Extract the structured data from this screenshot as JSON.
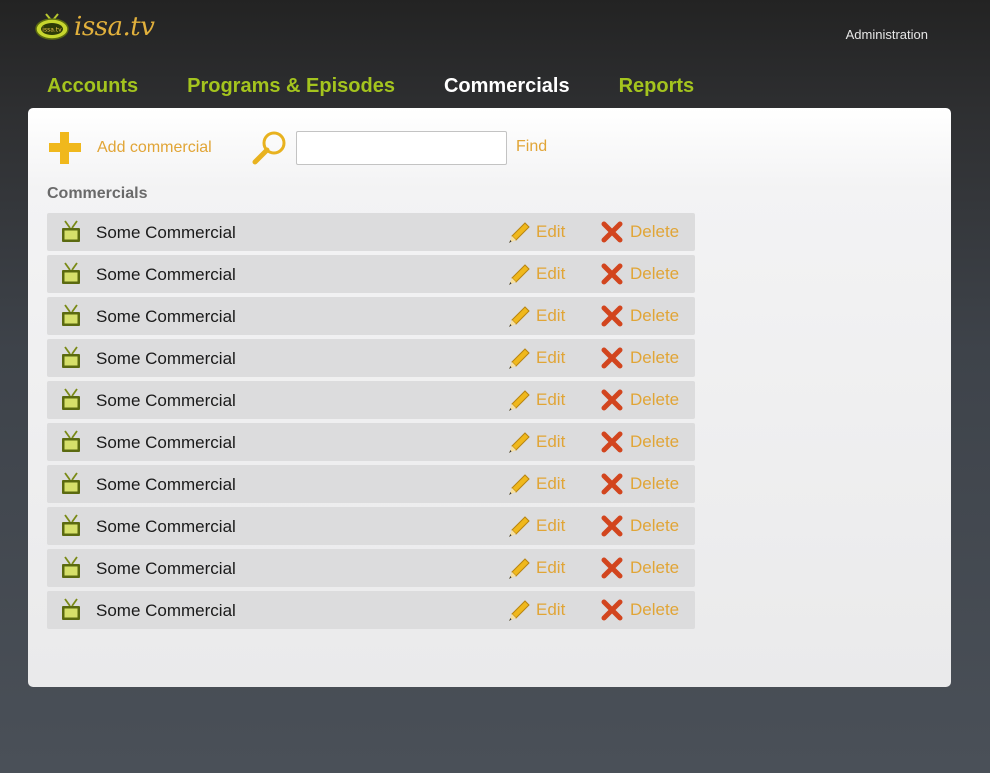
{
  "header": {
    "logo_text": "issa.tv",
    "logo_badge": "issa.tv",
    "admin_label": "Administration"
  },
  "nav": {
    "tabs": [
      {
        "label": "Accounts",
        "active": false
      },
      {
        "label": "Programs & Episodes",
        "active": false
      },
      {
        "label": "Commercials",
        "active": true
      },
      {
        "label": "Reports",
        "active": false
      }
    ]
  },
  "toolbar": {
    "add_label": "Add commercial",
    "search_value": "",
    "search_placeholder": "",
    "find_label": "Find"
  },
  "section_title": "Commercials",
  "items": [
    {
      "title": "Some Commercial",
      "edit_label": "Edit",
      "delete_label": "Delete"
    },
    {
      "title": "Some Commercial",
      "edit_label": "Edit",
      "delete_label": "Delete"
    },
    {
      "title": "Some Commercial",
      "edit_label": "Edit",
      "delete_label": "Delete"
    },
    {
      "title": "Some Commercial",
      "edit_label": "Edit",
      "delete_label": "Delete"
    },
    {
      "title": "Some Commercial",
      "edit_label": "Edit",
      "delete_label": "Delete"
    },
    {
      "title": "Some Commercial",
      "edit_label": "Edit",
      "delete_label": "Delete"
    },
    {
      "title": "Some Commercial",
      "edit_label": "Edit",
      "delete_label": "Delete"
    },
    {
      "title": "Some Commercial",
      "edit_label": "Edit",
      "delete_label": "Delete"
    },
    {
      "title": "Some Commercial",
      "edit_label": "Edit",
      "delete_label": "Delete"
    },
    {
      "title": "Some Commercial",
      "edit_label": "Edit",
      "delete_label": "Delete"
    }
  ],
  "icons": {
    "logo": "tv-logo-icon",
    "add": "plus-icon",
    "search": "magnifier-icon",
    "item": "tv-icon",
    "edit": "pencil-icon",
    "delete": "x-icon"
  },
  "colors": {
    "accent_green": "#a4c41e",
    "accent_orange": "#e1a536",
    "plus_yellow": "#f0b81c",
    "delete_red": "#d2451e"
  }
}
